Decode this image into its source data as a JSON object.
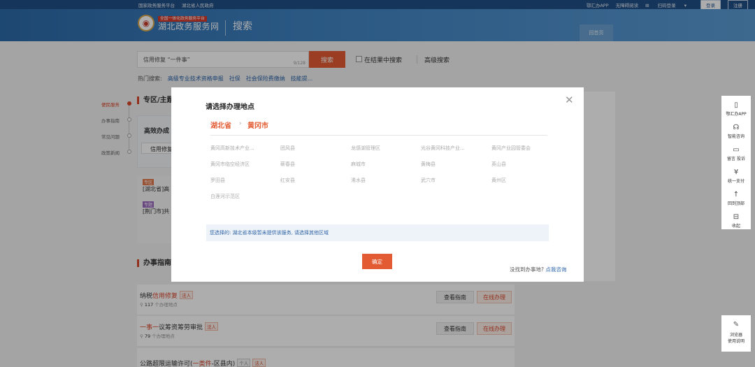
{
  "topbar": {
    "left_links": [
      "国家政务服务平台",
      "湖北省人民政府"
    ],
    "right_links": [
      "鄂汇办APP",
      "无障碍阅读",
      "扫码登录"
    ],
    "login_label": "登录",
    "register_label": "注册"
  },
  "header": {
    "logo_sub": "全国一体化政务服务平台",
    "logo_main": "湖北政务服务网",
    "title": "搜索",
    "back_label": "回首页"
  },
  "search": {
    "value": "信用修复 “一件事”",
    "count": "9/128",
    "button_label": "搜索",
    "in_results_label": "在结果中搜索",
    "advanced_label": "高级搜索"
  },
  "hot": {
    "label": "热门搜索:",
    "items": [
      "高级专业技术资格申报",
      "社保",
      "社会保险费缴纳",
      "技能提..."
    ]
  },
  "rail": {
    "items": [
      "便民服务",
      "办事指南",
      "常见问题",
      "政策新闻"
    ]
  },
  "main": {
    "section_zone": "专区/主题",
    "efficient_title": "高效办成",
    "efficient_input": "信用修复",
    "items": [
      {
        "tag": "专区",
        "text": "[湖北省]高"
      },
      {
        "tag": "专题",
        "text": "[荆门市]共"
      }
    ],
    "guide_section": "办事指南",
    "guides": [
      {
        "pre": "纳税",
        "hl": "信用修复",
        "post": "",
        "badges": [
          "法人"
        ],
        "count_num": "117",
        "count_text": "个办理地点"
      },
      {
        "pre": "",
        "hl": "一事一",
        "post": "议筹资筹劳审批",
        "badges": [
          "法人"
        ],
        "count_num": "79",
        "count_text": "个办理地点"
      },
      {
        "pre": "公路超限运输许可(",
        "hl": "一类件",
        "post": "-区县内)",
        "badges": [
          "个人",
          "法人"
        ],
        "count_num": "",
        "count_text": ""
      }
    ],
    "view_label": "查看指南",
    "online_label": "在线办理"
  },
  "toolbar": {
    "items": [
      "鄂汇办APP",
      "智能咨询",
      "留言 投诉",
      "统一支付",
      "回到顶部",
      "收起"
    ],
    "browser_label_1": "浏览器",
    "browser_label_2": "使用说明"
  },
  "modal": {
    "title": "请选择办理地点",
    "crumb_province": "湖北省",
    "crumb_city": "黄冈市",
    "regions": [
      "黄冈高新技术产业...",
      "团风县",
      "龙感湖管理区",
      "光谷黄冈科技产业...",
      "黄冈产业园管委会",
      "黄冈市临空经济区",
      "蕲春县",
      "麻城市",
      "黄梅县",
      "英山县",
      "罗田县",
      "红安县",
      "浠水县",
      "武穴市",
      "黄州区",
      "白莲河示范区"
    ],
    "notice": "您选择的: 湖北省本级暂未提供该服务, 请选择其他区域",
    "confirm_label": "确定",
    "help_text": "没找到办事地?",
    "help_link": "点我咨询"
  }
}
